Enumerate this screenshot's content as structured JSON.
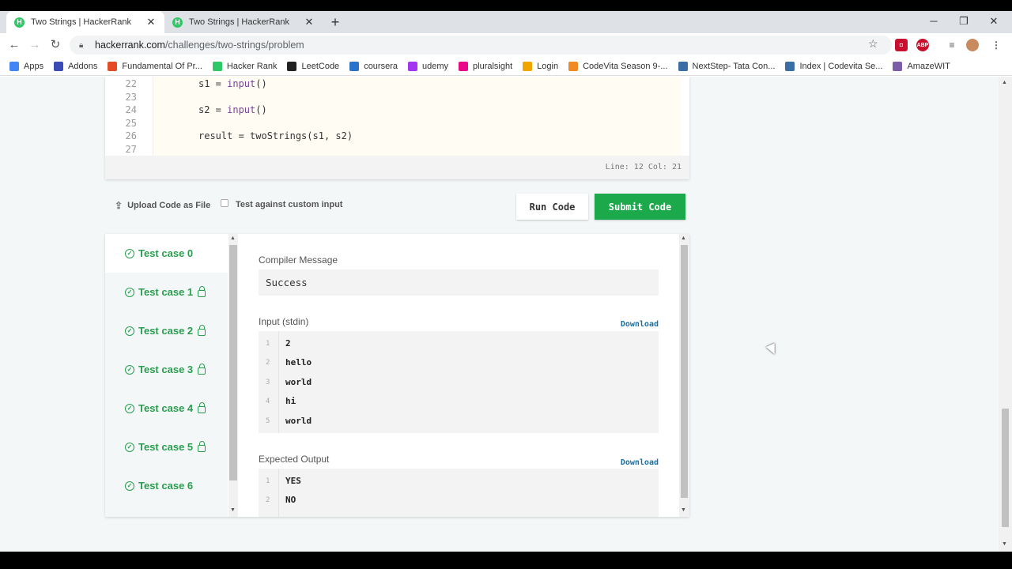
{
  "browser": {
    "tabs": [
      {
        "title": "Two Strings | HackerRank",
        "favicon": "H"
      },
      {
        "title": "Two Strings | HackerRank",
        "favicon": "H"
      }
    ],
    "url_host": "hackerrank.com",
    "url_path": "/challenges/two-strings/problem",
    "bookmarks": [
      {
        "label": "Apps",
        "color": "#4285f4"
      },
      {
        "label": "Addons",
        "color": "#3c4ab5"
      },
      {
        "label": "Fundamental Of Pr...",
        "color": "#e34c26"
      },
      {
        "label": "Hacker Rank",
        "color": "#2ec866"
      },
      {
        "label": "LeetCode",
        "color": "#222222"
      },
      {
        "label": "coursera",
        "color": "#2a73cc"
      },
      {
        "label": "udemy",
        "color": "#a435f0"
      },
      {
        "label": "pluralsight",
        "color": "#e80a89"
      },
      {
        "label": "Login",
        "color": "#f0a500"
      },
      {
        "label": "CodeVita Season 9-...",
        "color": "#f08a24"
      },
      {
        "label": "NextStep- Tata Con...",
        "color": "#3a6ea5"
      },
      {
        "label": "Index | Codevita Se...",
        "color": "#3a6ea5"
      },
      {
        "label": "AmazeWIT",
        "color": "#7b5ea7"
      }
    ]
  },
  "editor": {
    "lines": [
      {
        "n": "22",
        "text": "s1 = input()"
      },
      {
        "n": "23",
        "text": ""
      },
      {
        "n": "24",
        "text": "s2 = input()"
      },
      {
        "n": "25",
        "text": ""
      },
      {
        "n": "26",
        "text": "result = twoStrings(s1, s2)"
      },
      {
        "n": "27",
        "text": ""
      }
    ],
    "status": "Line: 12 Col: 21"
  },
  "actions": {
    "upload_label": "Upload Code as File",
    "custom_input_label": "Test against custom input",
    "run_label": "Run Code",
    "submit_label": "Submit Code"
  },
  "testcases": [
    {
      "label": "Test case 0",
      "locked": false
    },
    {
      "label": "Test case 1",
      "locked": true
    },
    {
      "label": "Test case 2",
      "locked": true
    },
    {
      "label": "Test case 3",
      "locked": true
    },
    {
      "label": "Test case 4",
      "locked": true
    },
    {
      "label": "Test case 5",
      "locked": true
    },
    {
      "label": "Test case 6",
      "locked": false
    }
  ],
  "output": {
    "compiler_label": "Compiler Message",
    "compiler_message": "Success",
    "input_label": "Input (stdin)",
    "download_label": "Download",
    "input_lines": [
      "2",
      "hello",
      "world",
      "hi",
      "world"
    ],
    "expected_label": "Expected Output",
    "expected_lines": [
      "YES",
      "NO"
    ]
  }
}
